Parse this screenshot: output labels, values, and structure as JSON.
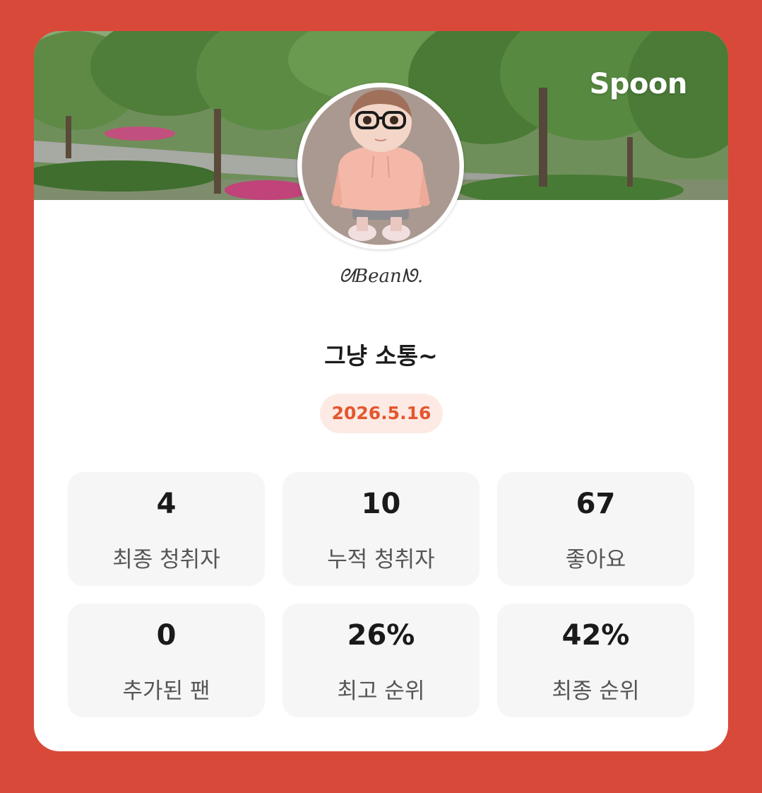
{
  "brand": {
    "name": "Spoon"
  },
  "profile": {
    "username": "ᘛBeanᘚ.",
    "room_title": "그냥 소통~",
    "date": "2026.5.16"
  },
  "stats": [
    {
      "value": "4",
      "label": "최종 청취자"
    },
    {
      "value": "10",
      "label": "누적 청취자"
    },
    {
      "value": "67",
      "label": "좋아요"
    },
    {
      "value": "0",
      "label": "추가된 팬"
    },
    {
      "value": "26%",
      "label": "최고 순위"
    },
    {
      "value": "42%",
      "label": "최종 순위"
    }
  ],
  "colors": {
    "background": "#d9493a",
    "card": "#ffffff",
    "accent": "#e4572e",
    "badge_bg": "#fdeae4",
    "stat_bg": "#f6f6f6"
  }
}
